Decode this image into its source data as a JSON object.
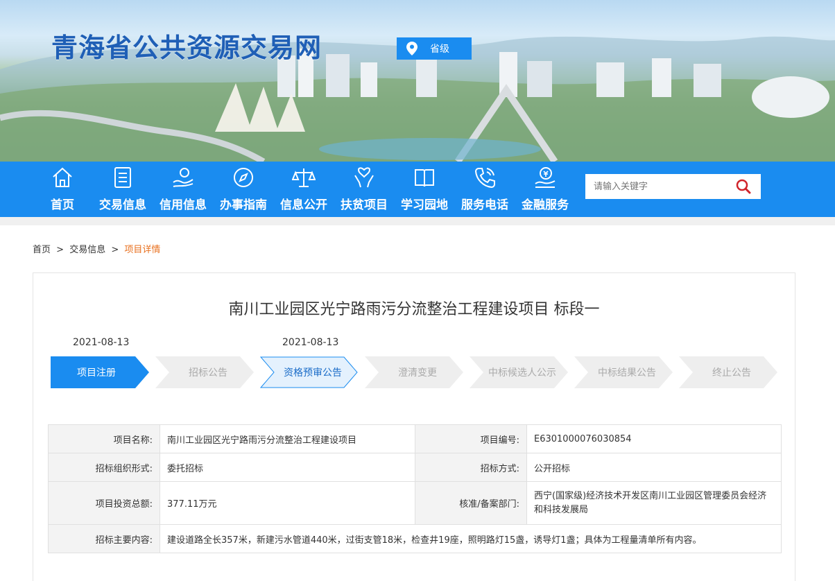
{
  "site": {
    "title": "青海省公共资源交易网",
    "region": "省级"
  },
  "nav": {
    "items": [
      {
        "label": "首页",
        "icon": "home-icon"
      },
      {
        "label": "交易信息",
        "icon": "document-icon"
      },
      {
        "label": "信用信息",
        "icon": "hand-credit-icon"
      },
      {
        "label": "办事指南",
        "icon": "compass-icon"
      },
      {
        "label": "信息公开",
        "icon": "scale-icon"
      },
      {
        "label": "扶贫项目",
        "icon": "heart-hands-icon"
      },
      {
        "label": "学习园地",
        "icon": "book-icon"
      },
      {
        "label": "服务电话",
        "icon": "phone-icon"
      },
      {
        "label": "金融服务",
        "icon": "finance-icon"
      }
    ],
    "search_placeholder": "请输入关键字"
  },
  "breadcrumb": {
    "home": "首页",
    "sep": ">",
    "trade": "交易信息",
    "current": "项目详情"
  },
  "project": {
    "title": "南川工业园区光宁路雨污分流整治工程建设项目 标段一",
    "dates": [
      "2021-08-13",
      "2021-08-13"
    ],
    "steps": [
      {
        "label": "项目注册",
        "state": "active"
      },
      {
        "label": "招标公告",
        "state": "inactive"
      },
      {
        "label": "资格预审公告",
        "state": "done"
      },
      {
        "label": "澄清变更",
        "state": "inactive"
      },
      {
        "label": "中标候选人公示",
        "state": "inactive"
      },
      {
        "label": "中标结果公告",
        "state": "inactive"
      },
      {
        "label": "终止公告",
        "state": "inactive"
      }
    ]
  },
  "info": {
    "name_label": "项目名称:",
    "name": "南川工业园区光宁路雨污分流整治工程建设项目",
    "code_label": "项目编号:",
    "code": "E6301000076030854",
    "org_form_label": "招标组织形式:",
    "org_form": "委托招标",
    "method_label": "招标方式:",
    "method": "公开招标",
    "investment_label": "项目投资总额:",
    "investment": "377.11万元",
    "approval_label": "核准/备案部门:",
    "approval": "西宁(国家级)经济技术开发区南川工业园区管理委员会经济和科技发展局",
    "content_label": "招标主要内容:",
    "content": "建设道路全长357米，新建污水管道440米，过街支管18米，检查井19座，照明路灯15盏，诱导灯1盏；具体为工程量清单所有内容。"
  },
  "colors": {
    "brand_blue": "#1a8cf0",
    "title_blue": "#1f5fb6",
    "breadcrumb_current": "#e8701f",
    "step_inactive": "#eeeeee"
  }
}
